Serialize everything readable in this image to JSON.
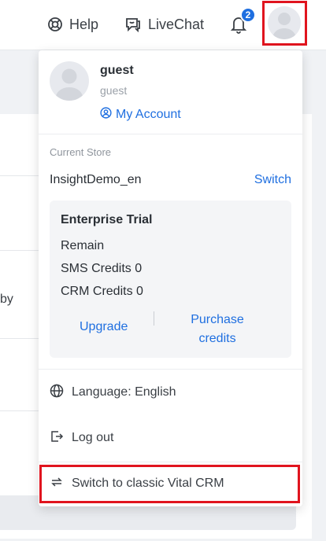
{
  "header": {
    "help_label": "Help",
    "livechat_label": "LiveChat",
    "notification_count": "2",
    "icons": [
      "lifebuoy-icon",
      "chat-icon",
      "bell-icon",
      "avatar-icon"
    ]
  },
  "background": {
    "partial_text": "by"
  },
  "dropdown": {
    "user": {
      "name": "guest",
      "subtitle": "guest",
      "my_account_label": "My Account"
    },
    "store": {
      "label": "Current Store",
      "name": "InsightDemo_en",
      "switch_label": "Switch"
    },
    "plan": {
      "title": "Enterprise Trial",
      "remain": "Remain",
      "sms_credits": "SMS Credits 0",
      "crm_credits": "CRM Credits 0",
      "upgrade_label": "Upgrade",
      "purchase_label": "Purchase credits"
    },
    "menu": {
      "language": "Language: English",
      "logout": "Log out",
      "switch_classic": "Switch to classic Vital CRM"
    }
  },
  "colors": {
    "accent": "#1f6fe0",
    "highlight_frame": "#e0141e"
  }
}
